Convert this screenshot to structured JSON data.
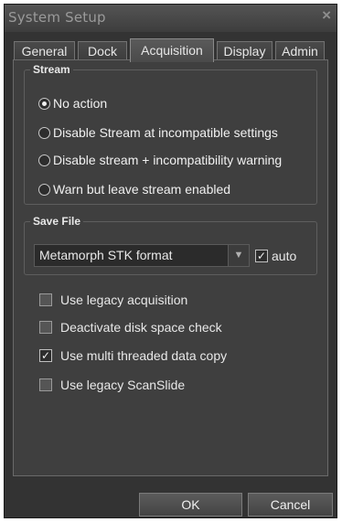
{
  "window": {
    "title": "System Setup",
    "close_glyph": "×"
  },
  "tabs": [
    {
      "label": "General",
      "active": false
    },
    {
      "label": "Dock",
      "active": false
    },
    {
      "label": "Acquisition",
      "active": true
    },
    {
      "label": "Display",
      "active": false
    },
    {
      "label": "Admin",
      "active": false
    }
  ],
  "stream": {
    "legend": "Stream",
    "options": [
      {
        "label": "No action",
        "selected": true
      },
      {
        "label": "Disable Stream at incompatible settings",
        "selected": false
      },
      {
        "label": "Disable stream + incompatibility warning",
        "selected": false
      },
      {
        "label": "Warn but leave stream enabled",
        "selected": false
      }
    ]
  },
  "save_file": {
    "legend": "Save File",
    "format_value": "Metamorph STK format",
    "auto_label": "auto",
    "auto_checked": true
  },
  "options": [
    {
      "label": "Use legacy acquisition",
      "checked": false
    },
    {
      "label": "Deactivate disk space check",
      "checked": false
    },
    {
      "label": "Use multi threaded data copy",
      "checked": true
    },
    {
      "label": "Use legacy ScanSlide",
      "checked": false
    }
  ],
  "buttons": {
    "ok": "OK",
    "cancel": "Cancel"
  },
  "colors": {
    "window_bg": "#333333",
    "panel_bg": "#3f3f3f",
    "text": "#f0f0f0"
  }
}
